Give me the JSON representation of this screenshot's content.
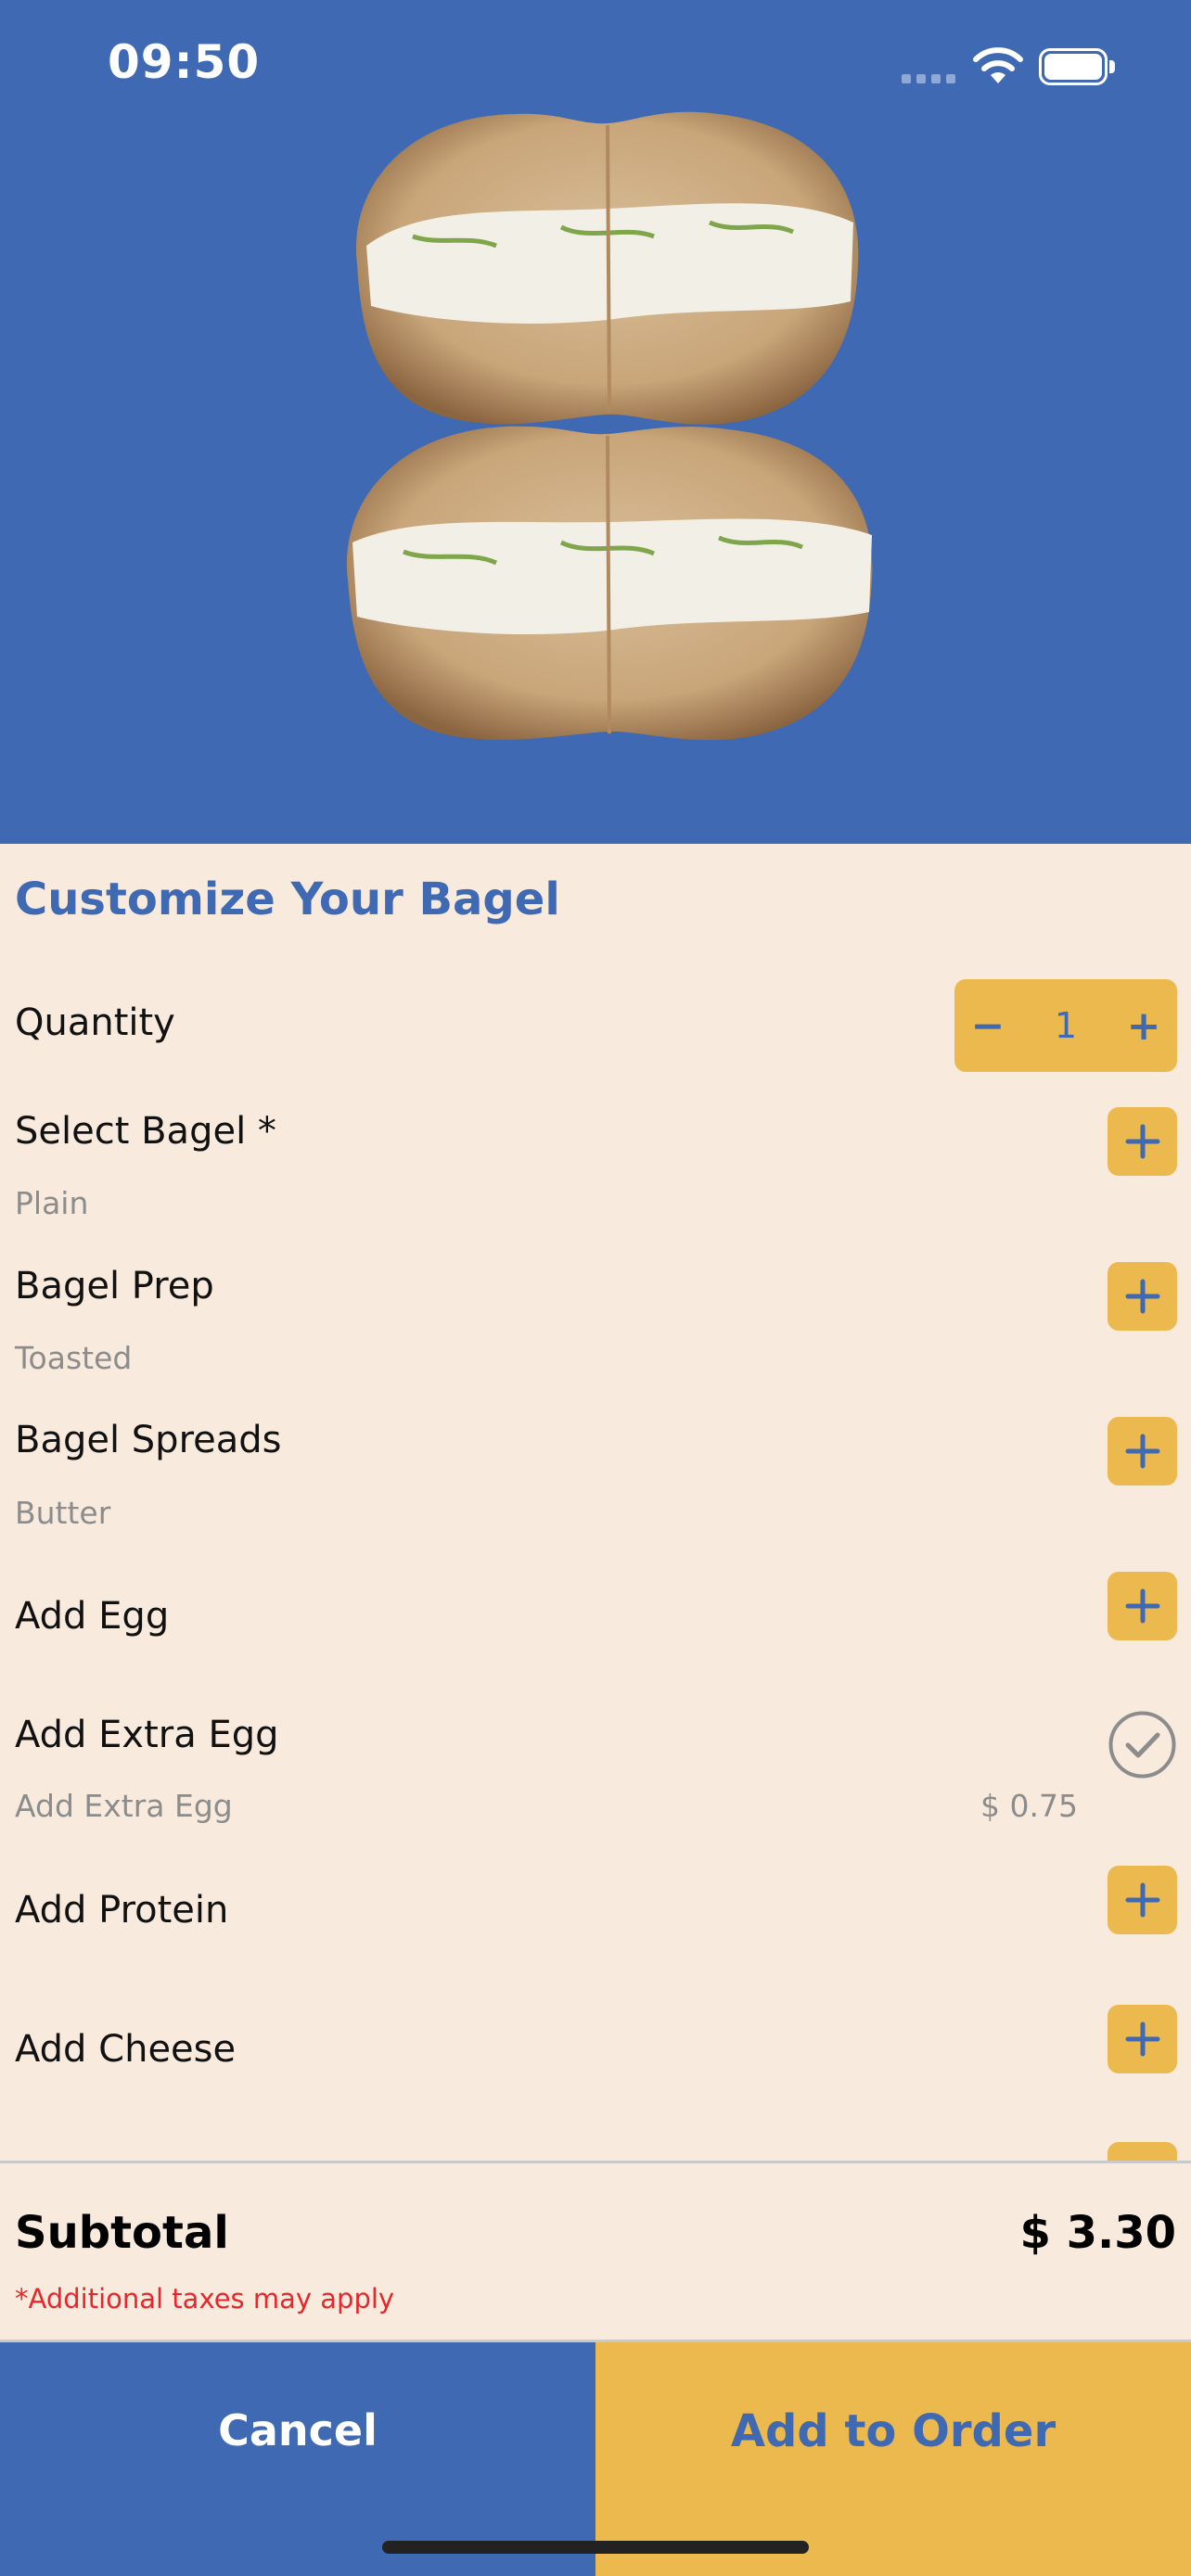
{
  "status_bar": {
    "time": "09:50"
  },
  "hero": {
    "image": "bagel-with-cream-cheese",
    "background_color": "#3F69B2"
  },
  "title": "Customize Your Bagel",
  "quantity": {
    "label": "Quantity",
    "value": "1",
    "minus": "−",
    "plus": "+"
  },
  "options": [
    {
      "label": "Select Bagel *",
      "selection": "Plain",
      "control": "plus-icon"
    },
    {
      "label": "Bagel Prep",
      "selection": "Toasted",
      "control": "plus-icon"
    },
    {
      "label": "Bagel Spreads",
      "selection": "Butter",
      "control": "plus-icon"
    },
    {
      "label": "Add Egg",
      "control": "plus-icon"
    },
    {
      "label": "Add Extra Egg",
      "selection": "Add Extra Egg",
      "price": "$ 0.75",
      "control": "check-circle-icon"
    },
    {
      "label": "Add Protein",
      "control": "plus-icon"
    },
    {
      "label": "Add Cheese",
      "control": "plus-icon"
    }
  ],
  "subtotal": {
    "label": "Subtotal",
    "value": "$ 3.30",
    "note": "*Additional taxes may apply"
  },
  "actions": {
    "cancel": "Cancel",
    "add_to_order": "Add to Order"
  },
  "colors": {
    "primary_blue": "#3F69B2",
    "accent_yellow": "#EBB94E",
    "background": "#F8EBDE",
    "warning_red": "#E8272C"
  }
}
